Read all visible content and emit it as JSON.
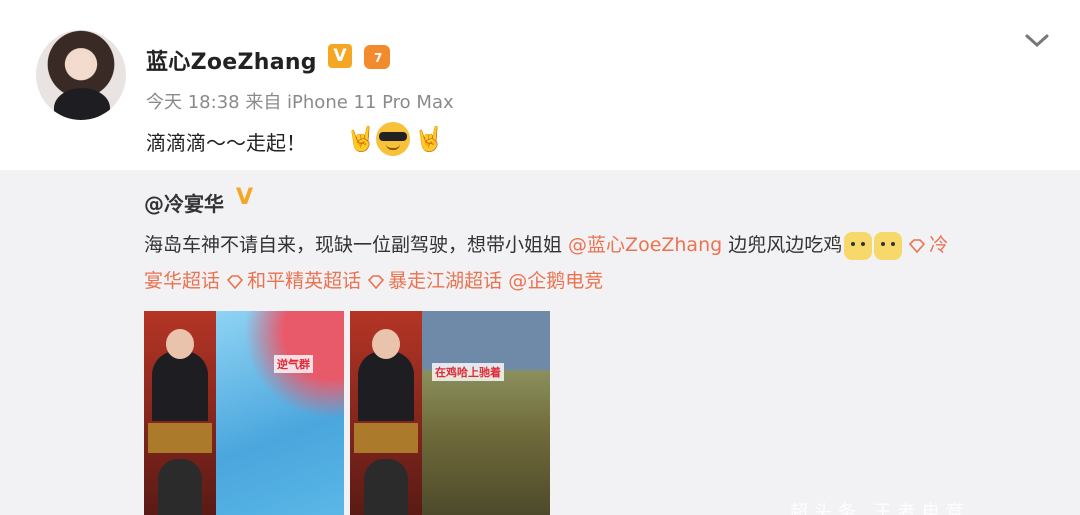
{
  "post": {
    "username": "蓝心ZoeZhang",
    "badge_v": "V",
    "vip_level": "7",
    "meta": "今天 18:38 来自 iPhone 11 Pro Max",
    "content": "滴滴滴～～走起！",
    "emojis": [
      "rock-hand",
      "cool-face",
      "rock-hand"
    ]
  },
  "repost": {
    "username": "@冷宴华",
    "badge_v": "V",
    "text_line1_prefix": "海岛车神不请自来，现缺一位副驾驶，想带小姐姐 ",
    "mention": "@蓝心ZoeZhang",
    "text_line1_suffix": " 边兜风边吃鸡",
    "topic_1a": "冷",
    "topic_1b": "宴华超话",
    "topic_2": "和平精英超话",
    "topic_3": "暴走江湖超话",
    "mention_2": "@企鹅电竞",
    "thumbs": [
      {
        "label": "逆气群"
      },
      {
        "label": "在鸡哈上驰着"
      }
    ]
  },
  "watermark": "超头条 王者电竞",
  "colors": {
    "link": "#eb7350",
    "repost_bg": "#f2f2f5",
    "badge": "#f5a623"
  }
}
